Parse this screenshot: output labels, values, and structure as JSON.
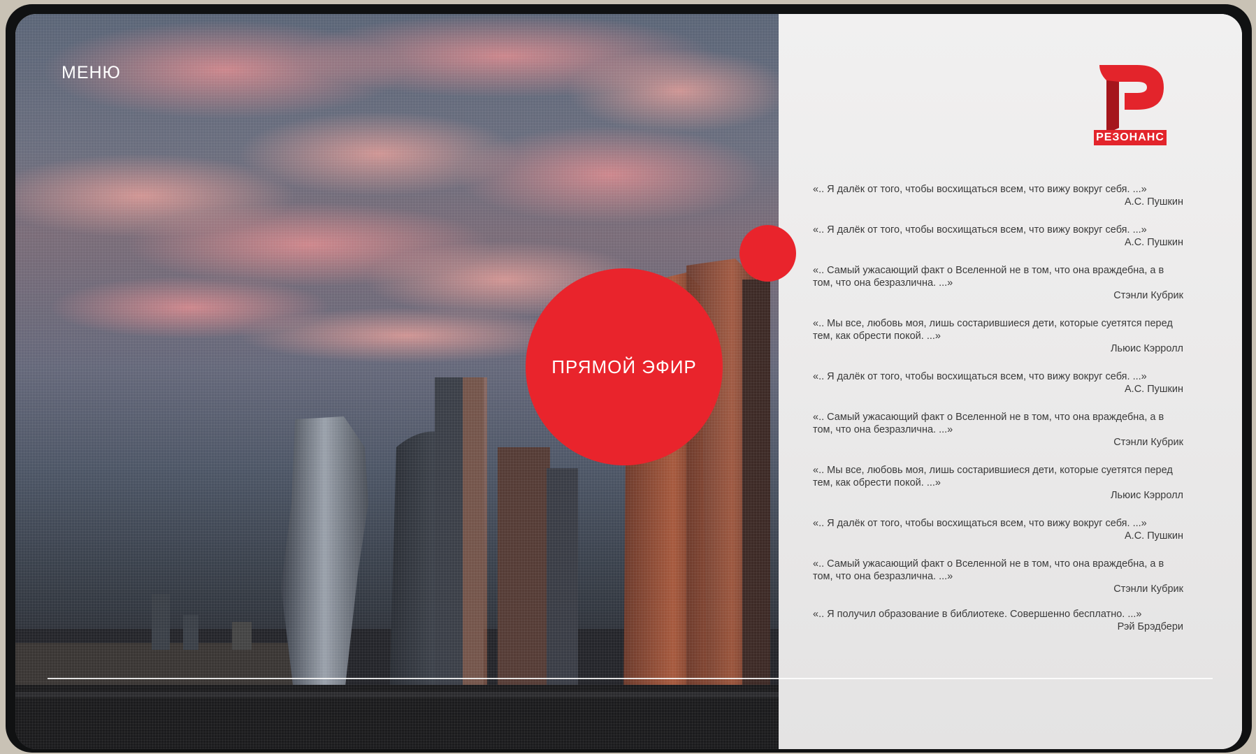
{
  "menu": {
    "label": "МЕНЮ"
  },
  "live": {
    "label": "ПРЯМОЙ ЭФИР"
  },
  "brand": {
    "name": "РЕЗОНАНС",
    "color": "#e3242b"
  },
  "quotes": [
    {
      "text": "«.. Я далёк от того, чтобы восхищаться всем, что вижу вокруг себя. ...»",
      "author": "А.С. Пушкин"
    },
    {
      "text": "«.. Я далёк от того, чтобы восхищаться всем, что вижу вокруг себя. ...»",
      "author": "А.С. Пушкин"
    },
    {
      "text": "«.. Самый ужасающий факт о Вселенной не в том, что она враждебна, а в том, что она безразлична. ...»",
      "author": "Стэнли Кубрик"
    },
    {
      "text": "«.. Мы все, любовь моя, лишь состарившиеся дети, которые суетятся перед тем, как обрести покой. ...»",
      "author": "Льюис Кэрролл"
    },
    {
      "text": "«.. Я далёк от того, чтобы восхищаться всем, что вижу вокруг себя. ...»",
      "author": "А.С. Пушкин"
    },
    {
      "text": "«.. Самый ужасающий факт о Вселенной не в том, что она враждебна, а в том, что она безразлична. ...»",
      "author": "Стэнли Кубрик"
    },
    {
      "text": "«.. Мы все, любовь моя, лишь состарившиеся дети, которые суетятся перед тем, как обрести покой. ...»",
      "author": "Льюис Кэрролл"
    },
    {
      "text": "«.. Я далёк от того, чтобы восхищаться всем, что вижу вокруг себя. ...»",
      "author": "А.С. Пушкин"
    },
    {
      "text": "«.. Самый ужасающий факт о Вселенной не в том, что она враждебна, а в том, что она безразлична. ...»",
      "author": "Стэнли Кубрик"
    },
    {
      "text": "«.. Я получил образование в библиотеке. Совершенно бесплатно. ...»",
      "author": "Рэй Брэдбери"
    }
  ]
}
